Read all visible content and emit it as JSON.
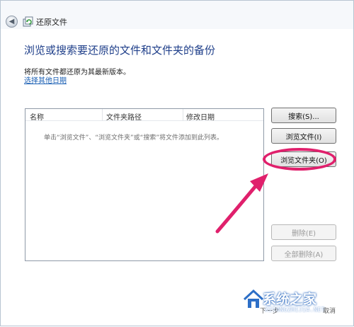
{
  "window": {
    "title": "还原文件",
    "back_icon": "back-arrow-icon",
    "app_icon": "restore-files-icon"
  },
  "main": {
    "heading": "浏览或搜索要还原的文件和文件夹的备份",
    "description": "将所有文件都还原为其最新版本。",
    "choose_date_link": "选择其他日期"
  },
  "file_list": {
    "columns": [
      "名称",
      "文件夹路径",
      "修改日期"
    ],
    "empty_message": "单击“浏览文件”、“浏览文件夹”或“搜索”将文件添加到此列表。"
  },
  "buttons": {
    "search": "搜索(S)...",
    "browse_files": "浏览文件(I)",
    "browse_folders": "浏览文件夹(O)",
    "remove": "删除(E)",
    "remove_all": "全部删除(A)"
  },
  "footer": {
    "next_partial": "下一步",
    "cancel_partial": "取消"
  },
  "watermark": {
    "text": "系统之家",
    "url": "XITONGZHIJIA.NET"
  },
  "colors": {
    "heading": "#1f3f8a",
    "link": "#1a5fb4",
    "annotation": "#e0206c"
  }
}
